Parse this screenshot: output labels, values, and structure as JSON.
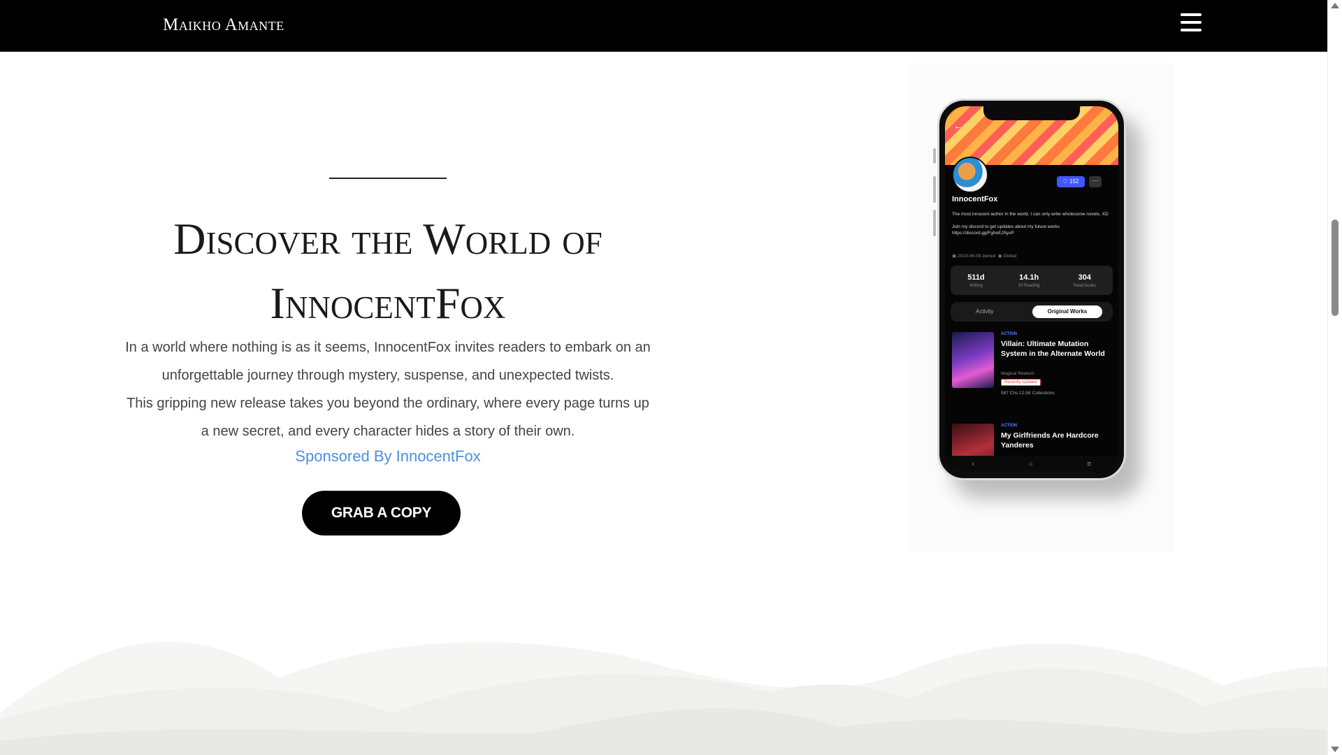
{
  "header": {
    "brand": "Maikho Amante",
    "menu_icon": "hamburger-menu-icon"
  },
  "hero": {
    "title_line1": "Discover the World of",
    "title_line2": "InnocentFox",
    "description_line1": "In a world where nothing is as it seems, InnocentFox invites readers to embark on an",
    "description_line2": "unforgettable journey through mystery, suspense, and unexpected twists.",
    "description_line3": "This gripping new release takes you beyond the ordinary, where every page turns up",
    "description_line4": "a new secret, and every character hides a story of their own.",
    "sponsor": "Sponsored By InnocentFox",
    "cta_label": "GRAB A COPY"
  },
  "phone": {
    "follow_count": "152",
    "more": "···",
    "profile_name": "InnocentFox",
    "bio_line1": "The most innocent author in the world. I can only write wholesome novels. XD",
    "bio_line2": "Join my discord to get updates about my future works",
    "bio_line3": "https://discord.gg/FgheEJSyxP",
    "joined": "2023-06-09 Joined",
    "location": "Global",
    "stats": [
      {
        "value": "511d",
        "label": "Writing"
      },
      {
        "value": "14.1h",
        "label": "Of Reading"
      },
      {
        "value": "304",
        "label": "Read books"
      }
    ],
    "tab_activity": "Activity",
    "tab_original": "Original Works",
    "books": [
      {
        "genre": "ACTION",
        "title": "Villain: Ultimate Mutation System in the Alternate World",
        "subgenre": "Magical Realism",
        "badge": "Recently updated",
        "stats": "587 Chs   12.5K Collections"
      },
      {
        "genre": "ACTION",
        "title": "My Girlfriends Are Hardcore Yanderes"
      }
    ]
  },
  "colors": {
    "topbar": "#000000",
    "sponsor_link": "#4a90e2",
    "cta_bg": "#000000",
    "wave_light": "#f4f4f2",
    "wave_dark": "#e9e9e5"
  }
}
